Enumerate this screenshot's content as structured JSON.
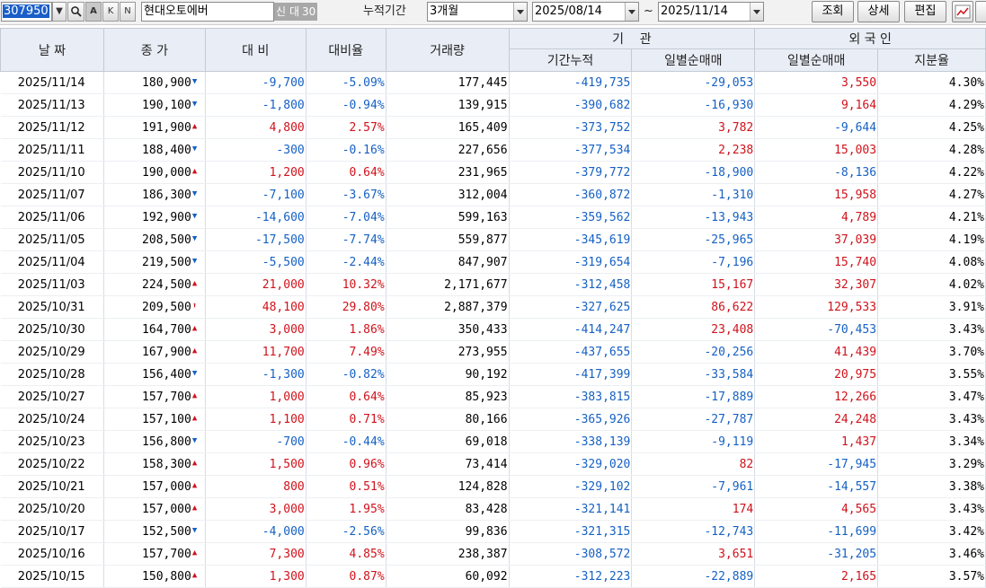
{
  "toolbar": {
    "code": "307950",
    "buttons_small": [
      "A",
      "K",
      "N"
    ],
    "stock_name": "현대오토에버",
    "tags": [
      "신",
      "대",
      "30"
    ],
    "period_label": "누적기간",
    "period_value": "3개월",
    "date_from": "2025/08/14",
    "date_sep": "~",
    "date_to": "2025/11/14",
    "query_button": "조회",
    "detail_button": "상세",
    "edit_button": "편집"
  },
  "headers": {
    "date": "날 짜",
    "close": "종 가",
    "change": "대 비",
    "change_rate": "대비율",
    "volume": "거래량",
    "institution": "기    관",
    "inst_cum": "기간누적",
    "inst_daily": "일별순매매",
    "foreign": "외 국 인",
    "frgn_daily": "일별순매매",
    "frgn_share": "지분율"
  },
  "colors": {
    "up": "#d0121b",
    "down": "#1560c4",
    "header_bg": "#e9eef6"
  },
  "rows": [
    {
      "date": "2025/11/14",
      "close": "180,900",
      "dir": "down",
      "change": "-9,700",
      "rate": "-5.09%",
      "volume": "177,445",
      "inst_cum": "-419,735",
      "inst_daily": "-29,053",
      "frgn_daily": "3,550",
      "share": "4.30%"
    },
    {
      "date": "2025/11/13",
      "close": "190,100",
      "dir": "down",
      "change": "-1,800",
      "rate": "-0.94%",
      "volume": "139,915",
      "inst_cum": "-390,682",
      "inst_daily": "-16,930",
      "frgn_daily": "9,164",
      "share": "4.29%"
    },
    {
      "date": "2025/11/12",
      "close": "191,900",
      "dir": "up",
      "change": "4,800",
      "rate": "2.57%",
      "volume": "165,409",
      "inst_cum": "-373,752",
      "inst_daily": "3,782",
      "frgn_daily": "-9,644",
      "share": "4.25%"
    },
    {
      "date": "2025/11/11",
      "close": "188,400",
      "dir": "down",
      "change": "-300",
      "rate": "-0.16%",
      "volume": "227,656",
      "inst_cum": "-377,534",
      "inst_daily": "2,238",
      "frgn_daily": "15,003",
      "share": "4.28%"
    },
    {
      "date": "2025/11/10",
      "close": "190,000",
      "dir": "up",
      "change": "1,200",
      "rate": "0.64%",
      "volume": "231,965",
      "inst_cum": "-379,772",
      "inst_daily": "-18,900",
      "frgn_daily": "-8,136",
      "share": "4.22%"
    },
    {
      "date": "2025/11/07",
      "close": "186,300",
      "dir": "down",
      "change": "-7,100",
      "rate": "-3.67%",
      "volume": "312,004",
      "inst_cum": "-360,872",
      "inst_daily": "-1,310",
      "frgn_daily": "15,958",
      "share": "4.27%"
    },
    {
      "date": "2025/11/06",
      "close": "192,900",
      "dir": "down",
      "change": "-14,600",
      "rate": "-7.04%",
      "volume": "599,163",
      "inst_cum": "-359,562",
      "inst_daily": "-13,943",
      "frgn_daily": "4,789",
      "share": "4.21%"
    },
    {
      "date": "2025/11/05",
      "close": "208,500",
      "dir": "down",
      "change": "-17,500",
      "rate": "-7.74%",
      "volume": "559,877",
      "inst_cum": "-345,619",
      "inst_daily": "-25,965",
      "frgn_daily": "37,039",
      "share": "4.19%"
    },
    {
      "date": "2025/11/04",
      "close": "219,500",
      "dir": "down",
      "change": "-5,500",
      "rate": "-2.44%",
      "volume": "847,907",
      "inst_cum": "-319,654",
      "inst_daily": "-7,196",
      "frgn_daily": "15,740",
      "share": "4.08%"
    },
    {
      "date": "2025/11/03",
      "close": "224,500",
      "dir": "up",
      "change": "21,000",
      "rate": "10.32%",
      "volume": "2,171,677",
      "inst_cum": "-312,458",
      "inst_daily": "15,167",
      "frgn_daily": "32,307",
      "share": "4.02%"
    },
    {
      "date": "2025/10/31",
      "close": "209,500",
      "dir": "limitup",
      "change": "48,100",
      "rate": "29.80%",
      "volume": "2,887,379",
      "inst_cum": "-327,625",
      "inst_daily": "86,622",
      "frgn_daily": "129,533",
      "share": "3.91%"
    },
    {
      "date": "2025/10/30",
      "close": "164,700",
      "dir": "up",
      "change": "3,000",
      "rate": "1.86%",
      "volume": "350,433",
      "inst_cum": "-414,247",
      "inst_daily": "23,408",
      "frgn_daily": "-70,453",
      "share": "3.43%"
    },
    {
      "date": "2025/10/29",
      "close": "167,900",
      "dir": "up",
      "change": "11,700",
      "rate": "7.49%",
      "volume": "273,955",
      "inst_cum": "-437,655",
      "inst_daily": "-20,256",
      "frgn_daily": "41,439",
      "share": "3.70%"
    },
    {
      "date": "2025/10/28",
      "close": "156,400",
      "dir": "down",
      "change": "-1,300",
      "rate": "-0.82%",
      "volume": "90,192",
      "inst_cum": "-417,399",
      "inst_daily": "-33,584",
      "frgn_daily": "20,975",
      "share": "3.55%"
    },
    {
      "date": "2025/10/27",
      "close": "157,700",
      "dir": "up",
      "change": "1,000",
      "rate": "0.64%",
      "volume": "85,923",
      "inst_cum": "-383,815",
      "inst_daily": "-17,889",
      "frgn_daily": "12,266",
      "share": "3.47%"
    },
    {
      "date": "2025/10/24",
      "close": "157,100",
      "dir": "up",
      "change": "1,100",
      "rate": "0.71%",
      "volume": "80,166",
      "inst_cum": "-365,926",
      "inst_daily": "-27,787",
      "frgn_daily": "24,248",
      "share": "3.43%"
    },
    {
      "date": "2025/10/23",
      "close": "156,800",
      "dir": "down",
      "change": "-700",
      "rate": "-0.44%",
      "volume": "69,018",
      "inst_cum": "-338,139",
      "inst_daily": "-9,119",
      "frgn_daily": "1,437",
      "share": "3.34%"
    },
    {
      "date": "2025/10/22",
      "close": "158,300",
      "dir": "up",
      "change": "1,500",
      "rate": "0.96%",
      "volume": "73,414",
      "inst_cum": "-329,020",
      "inst_daily": "82",
      "frgn_daily": "-17,945",
      "share": "3.29%"
    },
    {
      "date": "2025/10/21",
      "close": "157,000",
      "dir": "up",
      "change": "800",
      "rate": "0.51%",
      "volume": "124,828",
      "inst_cum": "-329,102",
      "inst_daily": "-7,961",
      "frgn_daily": "-14,557",
      "share": "3.38%"
    },
    {
      "date": "2025/10/20",
      "close": "157,000",
      "dir": "up",
      "change": "3,000",
      "rate": "1.95%",
      "volume": "83,428",
      "inst_cum": "-321,141",
      "inst_daily": "174",
      "frgn_daily": "4,565",
      "share": "3.43%"
    },
    {
      "date": "2025/10/17",
      "close": "152,500",
      "dir": "down",
      "change": "-4,000",
      "rate": "-2.56%",
      "volume": "99,836",
      "inst_cum": "-321,315",
      "inst_daily": "-12,743",
      "frgn_daily": "-11,699",
      "share": "3.42%"
    },
    {
      "date": "2025/10/16",
      "close": "157,700",
      "dir": "up",
      "change": "7,300",
      "rate": "4.85%",
      "volume": "238,387",
      "inst_cum": "-308,572",
      "inst_daily": "3,651",
      "frgn_daily": "-31,205",
      "share": "3.46%"
    },
    {
      "date": "2025/10/15",
      "close": "150,800",
      "dir": "up",
      "change": "1,300",
      "rate": "0.87%",
      "volume": "60,092",
      "inst_cum": "-312,223",
      "inst_daily": "-22,889",
      "frgn_daily": "2,165",
      "share": "3.57%"
    }
  ]
}
